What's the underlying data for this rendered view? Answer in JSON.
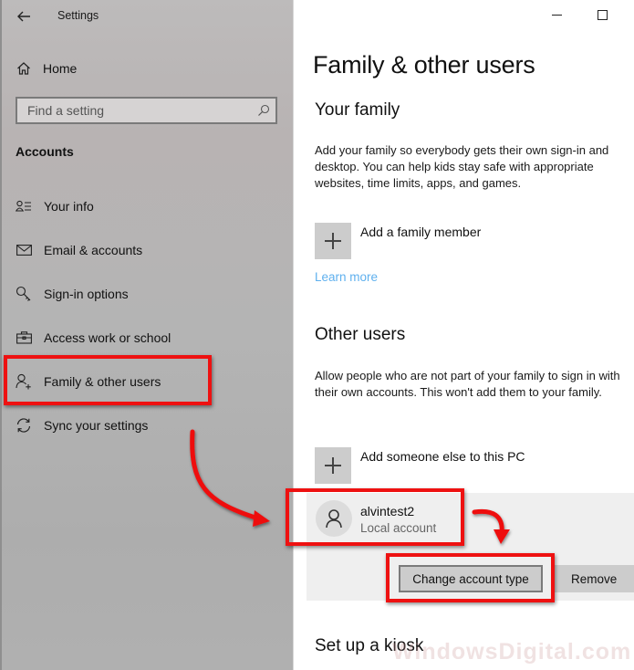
{
  "window": {
    "title": "Settings",
    "back_icon": "back-arrow-icon",
    "minimize_icon": "minimize-icon",
    "maximize_icon": "maximize-icon"
  },
  "sidebar": {
    "home": {
      "label": "Home",
      "icon": "home-icon"
    },
    "search": {
      "placeholder": "Find a setting",
      "value": "",
      "icon": "search-icon"
    },
    "section": "Accounts",
    "items": [
      {
        "label": "Your info",
        "icon": "person-list-icon"
      },
      {
        "label": "Email & accounts",
        "icon": "mail-icon"
      },
      {
        "label": "Sign-in options",
        "icon": "key-icon"
      },
      {
        "label": "Access work or school",
        "icon": "briefcase-icon"
      },
      {
        "label": "Family & other users",
        "icon": "person-add-icon",
        "selected": true
      },
      {
        "label": "Sync your settings",
        "icon": "sync-icon"
      }
    ]
  },
  "main": {
    "title": "Family & other users",
    "your_family": {
      "heading": "Your family",
      "description": "Add your family so everybody gets their own sign-in and desktop. You can help kids stay safe with appropriate websites, time limits, apps, and games.",
      "add_label": "Add a family member",
      "learn_more": "Learn more"
    },
    "other_users": {
      "heading": "Other users",
      "description": "Allow people who are not part of your family to sign in with their own accounts. This won't add them to your family.",
      "add_label": "Add someone else to this PC",
      "users": [
        {
          "name": "alvintest2",
          "type": "Local account",
          "icon": "user-icon"
        }
      ],
      "buttons": {
        "change_type": "Change account type",
        "remove": "Remove"
      }
    },
    "kiosk": {
      "heading": "Set up a kiosk"
    }
  },
  "colors": {
    "annotation": "#ee1111",
    "link": "#5fb0ee"
  },
  "watermark": "WindowsDigital.com"
}
